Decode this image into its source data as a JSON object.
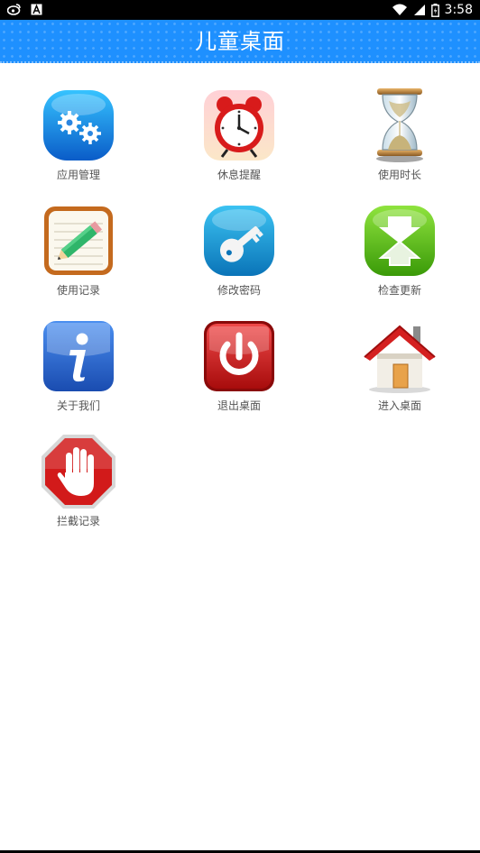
{
  "status_bar": {
    "time": "3:58",
    "left_icons": [
      "weibo-icon",
      "a-notification-icon"
    ],
    "right_icons": [
      "wifi-icon",
      "signal-icon",
      "battery-icon"
    ]
  },
  "header": {
    "title": "儿童桌面",
    "color": "#1e90ff"
  },
  "tiles": [
    {
      "label": "应用管理",
      "icon": "gears-icon"
    },
    {
      "label": "休息提醒",
      "icon": "alarm-clock-icon"
    },
    {
      "label": "使用时长",
      "icon": "hourglass-icon"
    },
    {
      "label": "使用记录",
      "icon": "notepad-pencil-icon"
    },
    {
      "label": "修改密码",
      "icon": "key-icon"
    },
    {
      "label": "检查更新",
      "icon": "update-arrows-icon"
    },
    {
      "label": "关于我们",
      "icon": "info-icon"
    },
    {
      "label": "退出桌面",
      "icon": "power-icon"
    },
    {
      "label": "进入桌面",
      "icon": "house-icon"
    },
    {
      "label": "拦截记录",
      "icon": "stop-hand-icon"
    }
  ]
}
